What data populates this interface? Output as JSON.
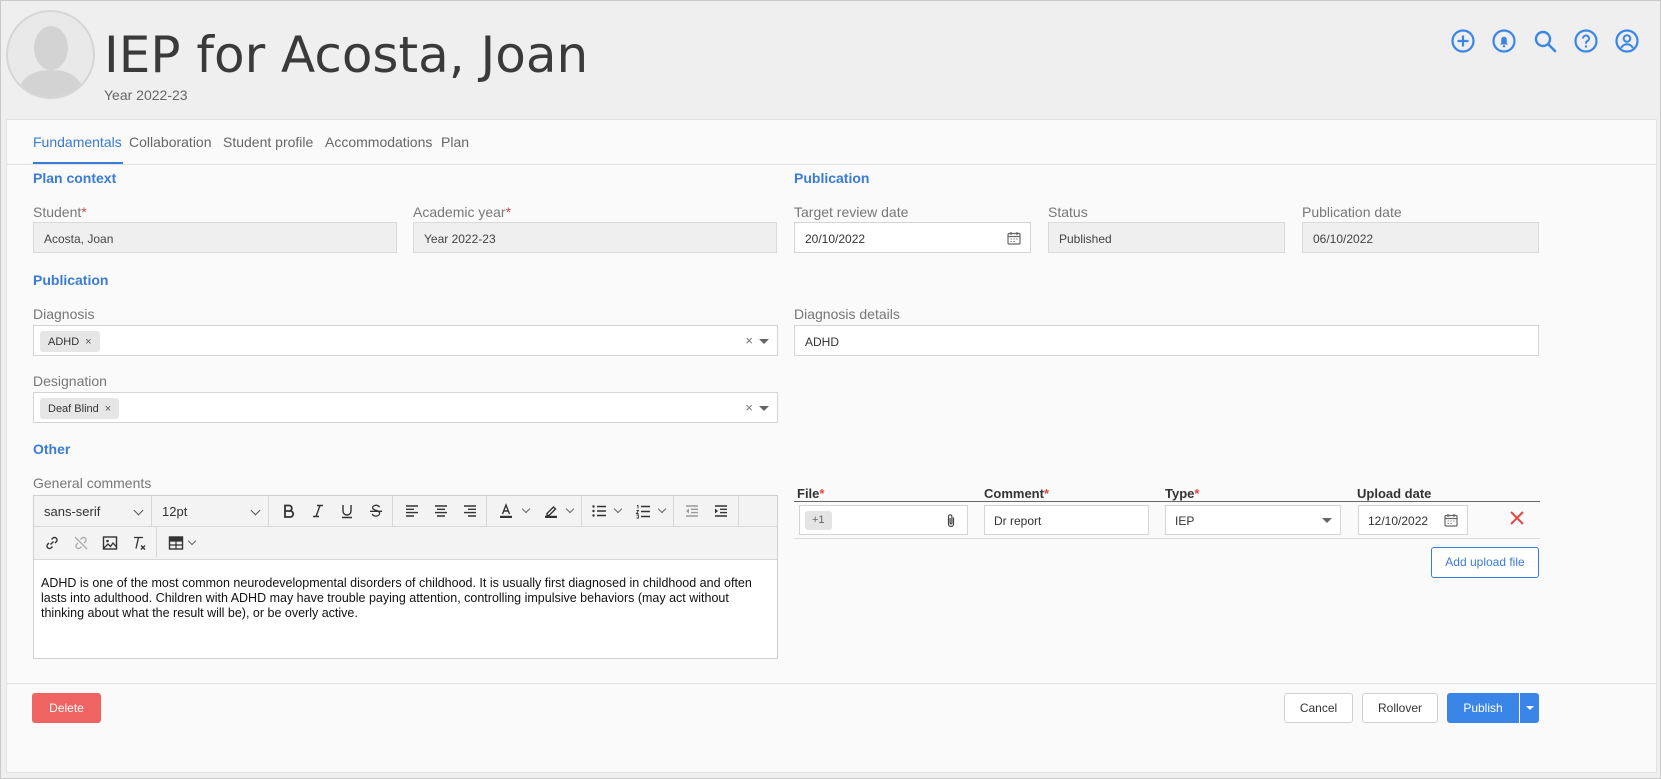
{
  "header": {
    "title": "IEP for Acosta, Joan",
    "subtitle": "Year 2022-23",
    "icons": [
      "add-circle-icon",
      "bell-icon",
      "search-icon",
      "help-icon",
      "account-icon"
    ]
  },
  "tabs": [
    {
      "label": "Fundamentals",
      "active": true
    },
    {
      "label": "Collaboration",
      "active": false
    },
    {
      "label": "Student profile",
      "active": false
    },
    {
      "label": "Accommodations",
      "active": false
    },
    {
      "label": "Plan",
      "active": false
    }
  ],
  "plan_context": {
    "title": "Plan context",
    "student_label": "Student",
    "student_value": "Acosta, Joan",
    "academic_year_label": "Academic year",
    "academic_year_value": "Year 2022-23",
    "required_mark": "*"
  },
  "publication_top": {
    "title": "Publication",
    "target_review_label": "Target review date",
    "target_review_value": "20/10/2022",
    "status_label": "Status",
    "status_value": "Published",
    "publication_date_label": "Publication date",
    "publication_date_value": "06/10/2022"
  },
  "publication_mid": {
    "title": "Publication",
    "diagnosis_label": "Diagnosis",
    "diagnosis_chip": "ADHD",
    "diagnosis_details_label": "Diagnosis details",
    "diagnosis_details_value": "ADHD",
    "designation_label": "Designation",
    "designation_chip": "Deaf Blind",
    "chip_remove": "×",
    "clear_all": "×"
  },
  "other": {
    "title": "Other",
    "comments_label": "General comments",
    "font_family": "sans-serif",
    "font_size": "12pt",
    "content": "ADHD is one of the most common neurodevelopmental disorders of childhood. It is usually first diagnosed in childhood and often lasts into adulthood. Children with ADHD may have trouble paying attention, controlling impulsive behaviors (may act without thinking about what the result will be), or be overly active."
  },
  "uploads": {
    "headers": {
      "file": "File",
      "comment": "Comment",
      "type": "Type",
      "upload_date": "Upload date"
    },
    "row": {
      "file_badge": "+1",
      "comment": "Dr report",
      "type": "IEP",
      "upload_date": "12/10/2022"
    },
    "add_button": "Add upload file"
  },
  "footer": {
    "delete": "Delete",
    "cancel": "Cancel",
    "rollover": "Rollover",
    "publish": "Publish"
  },
  "colors": {
    "accent": "#3a7bd5",
    "danger": "#f06363",
    "primary": "#3a86e8",
    "required": "#e04848"
  }
}
